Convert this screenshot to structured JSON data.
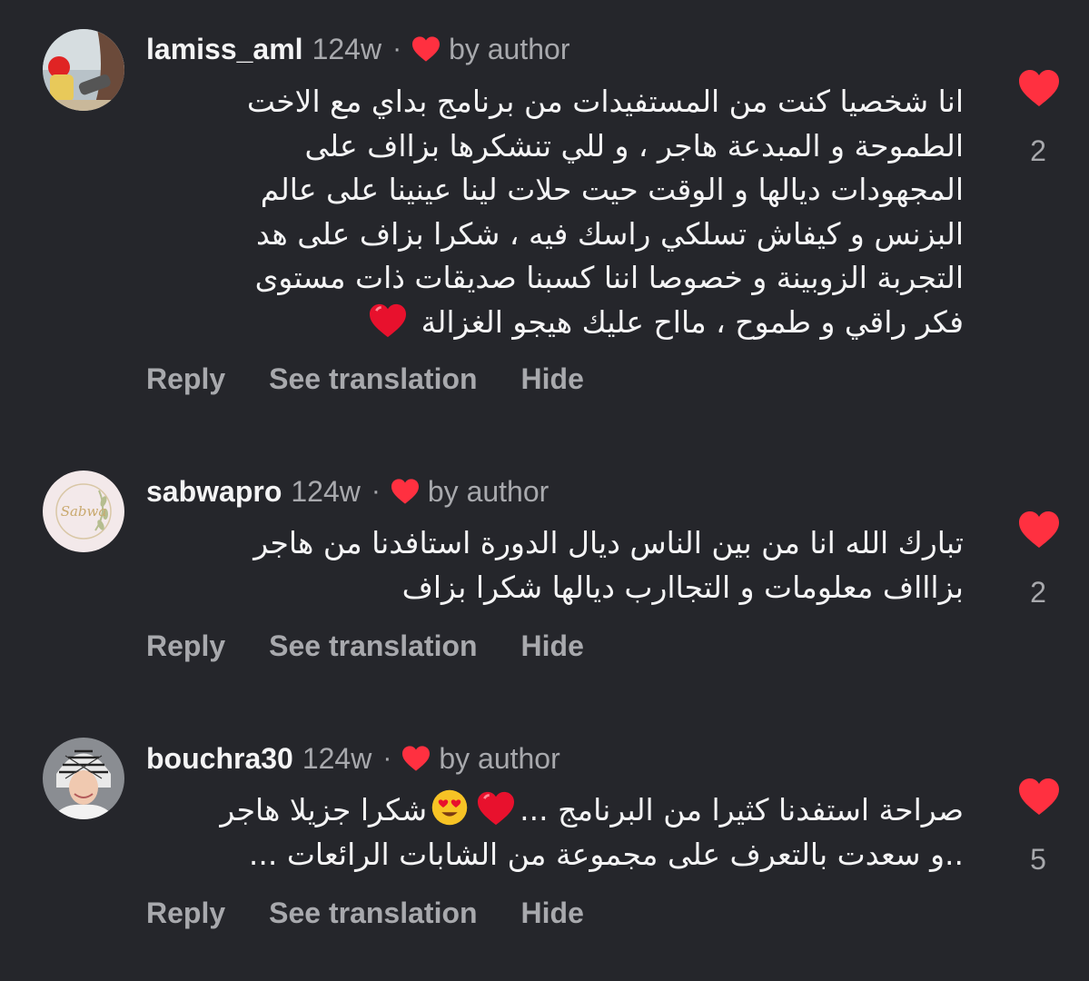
{
  "comments": [
    {
      "username": "lamiss_aml",
      "time": "124w",
      "separator": "·",
      "author_liked_label": "by author",
      "text_lines": [
        "انا شخصيا كنت من المستفيدات من برنامج بداي مع الاخت",
        "الطموحة و المبدعة هاجر ،  و للي تنشكرها بزااف على",
        "المجهودات ديالها و الوقت حيت حلات لينا عينينا على عالم",
        "البزنس و كيفاش تسلكي راسك فيه ، شكرا بزاف على هد",
        "التجربة الزوبينة و خصوصا اننا كسبنا صديقات ذات مستوى",
        "فكر راقي و طموح ، مااح عليك هيجو الغزالة"
      ],
      "like_count": "2",
      "actions": {
        "reply": "Reply",
        "translate": "See translation",
        "hide": "Hide"
      }
    },
    {
      "username": "sabwapro",
      "time": "124w",
      "separator": "·",
      "author_liked_label": "by author",
      "avatar_text": "Sabwa",
      "text_lines": [
        "تبارك الله انا من بين الناس ديال الدورة استافدنا من هاجر",
        "بزاااف معلومات و التجاارب ديالها شكرا بزاف"
      ],
      "like_count": "2",
      "actions": {
        "reply": "Reply",
        "translate": "See translation",
        "hide": "Hide"
      }
    },
    {
      "username": "bouchra30",
      "time": "124w",
      "separator": "·",
      "author_liked_label": "by author",
      "text_line1_start": "صراحة استفدنا كثيرا من البرنامج ...",
      "text_line1_end": "شكرا جزيلا هاجر",
      "text_line2": "..و سعدت بالتعرف على مجموعة من الشابات الرائعات ...",
      "like_count": "5",
      "actions": {
        "reply": "Reply",
        "translate": "See translation",
        "hide": "Hide"
      }
    }
  ],
  "colors": {
    "background": "#25262b",
    "text": "#f4f4f5",
    "muted": "#a8a9ad",
    "heart": "#ff3040"
  }
}
